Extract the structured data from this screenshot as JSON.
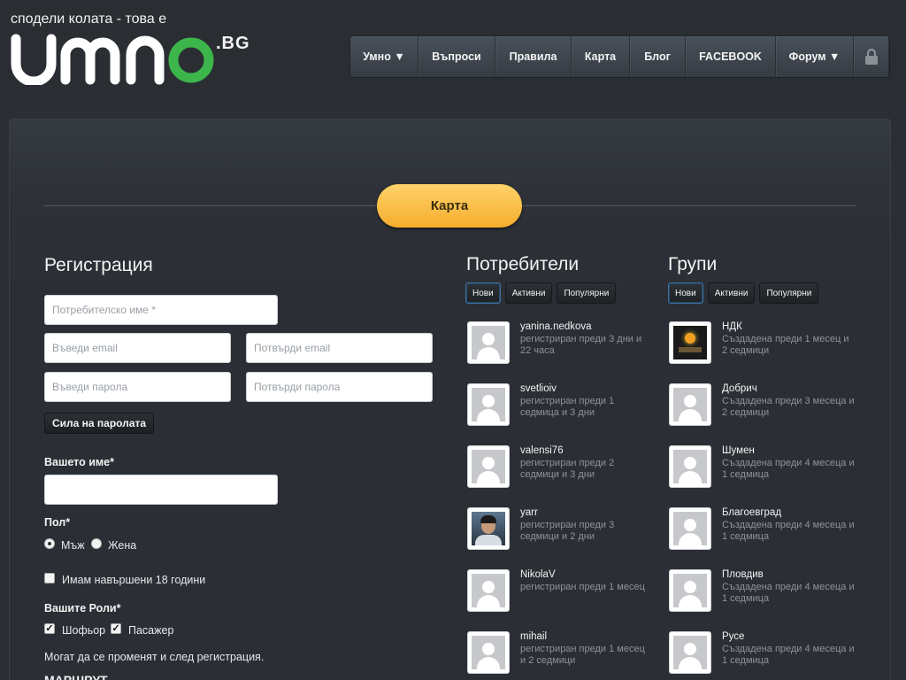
{
  "header": {
    "tagline": "сподели колата - това е",
    "logo_text": "umno",
    "logo_suffix": ".BG"
  },
  "nav": [
    {
      "label": "Умно ▼",
      "width": 77
    },
    {
      "label": "Въпроси",
      "width": 87
    },
    {
      "label": "Правила",
      "width": 86
    },
    {
      "label": "Карта",
      "width": 66
    },
    {
      "label": "Блог",
      "width": 63
    },
    {
      "label": "FACEBOOK",
      "width": 102
    },
    {
      "label": "Форум ▼",
      "width": 88
    }
  ],
  "colors": {
    "accent_orange": "#f5ad2c",
    "logo_green": "#3cb54a",
    "active_tab": "#3d6fa0"
  },
  "page_button": "Карта",
  "registration": {
    "title": "Регистрация",
    "username_placeholder": "Потребителско име *",
    "email_placeholder": "Въведи email",
    "email_confirm_placeholder": "Потвърди email",
    "password_placeholder": "Въведи парола",
    "password_confirm_placeholder": "Потвърди парола",
    "strength_button": "Сила на паролата",
    "name_label": "Вашето име*",
    "name_value": "",
    "gender_label": "Пол*",
    "gender_male": "Мъж",
    "gender_female": "Жена",
    "gender_selected": "Мъж",
    "age_checkbox": "Имам навършени 18 години",
    "roles_label": "Вашите Роли*",
    "role_driver": "Шофьор",
    "role_passenger": "Пасажер",
    "roles_note": "Могат да се променят и след регистрация.",
    "route_label": "МАРШРУТ"
  },
  "users": {
    "title": "Потребители",
    "tabs": [
      "Нови",
      "Активни",
      "Популярни"
    ],
    "active_tab": "Нови",
    "items": [
      {
        "name": "yanina.nedkova",
        "meta": "регистриран преди 3 дни и 22 часа",
        "avatar": "placeholder"
      },
      {
        "name": "svetlioiv",
        "meta": "регистриран преди 1 седмица и 3 дни",
        "avatar": "placeholder"
      },
      {
        "name": "valensi76",
        "meta": "регистриран преди 2 седмици и 3 дни",
        "avatar": "placeholder"
      },
      {
        "name": "yarr",
        "meta": "регистриран преди 3 седмици и 2 дни",
        "avatar": "photo"
      },
      {
        "name": "NikolaV",
        "meta": "регистриран преди 1 месец",
        "avatar": "placeholder"
      },
      {
        "name": "mihail",
        "meta": "регистриран преди 1 месец и 2 седмици",
        "avatar": "placeholder"
      }
    ]
  },
  "groups": {
    "title": "Групи",
    "tabs": [
      "Нови",
      "Активни",
      "Популярни"
    ],
    "active_tab": "Нови",
    "items": [
      {
        "name": "НДК",
        "meta": "Създадена преди 1 месец и 2 седмици",
        "avatar": "logo"
      },
      {
        "name": "Добрич",
        "meta": "Създадена преди 3 месеца и 2 седмици",
        "avatar": "placeholder"
      },
      {
        "name": "Шумен",
        "meta": "Създадена преди 4 месеца и 1 седмица",
        "avatar": "placeholder"
      },
      {
        "name": "Благоевград",
        "meta": "Създадена преди 4 месеца и 1 седмица",
        "avatar": "placeholder"
      },
      {
        "name": "Пловдив",
        "meta": "Създадена преди 4 месеца и 1 седмица",
        "avatar": "placeholder"
      },
      {
        "name": "Русе",
        "meta": "Създадена преди 4 месеца и 1 седмица",
        "avatar": "placeholder"
      }
    ]
  }
}
